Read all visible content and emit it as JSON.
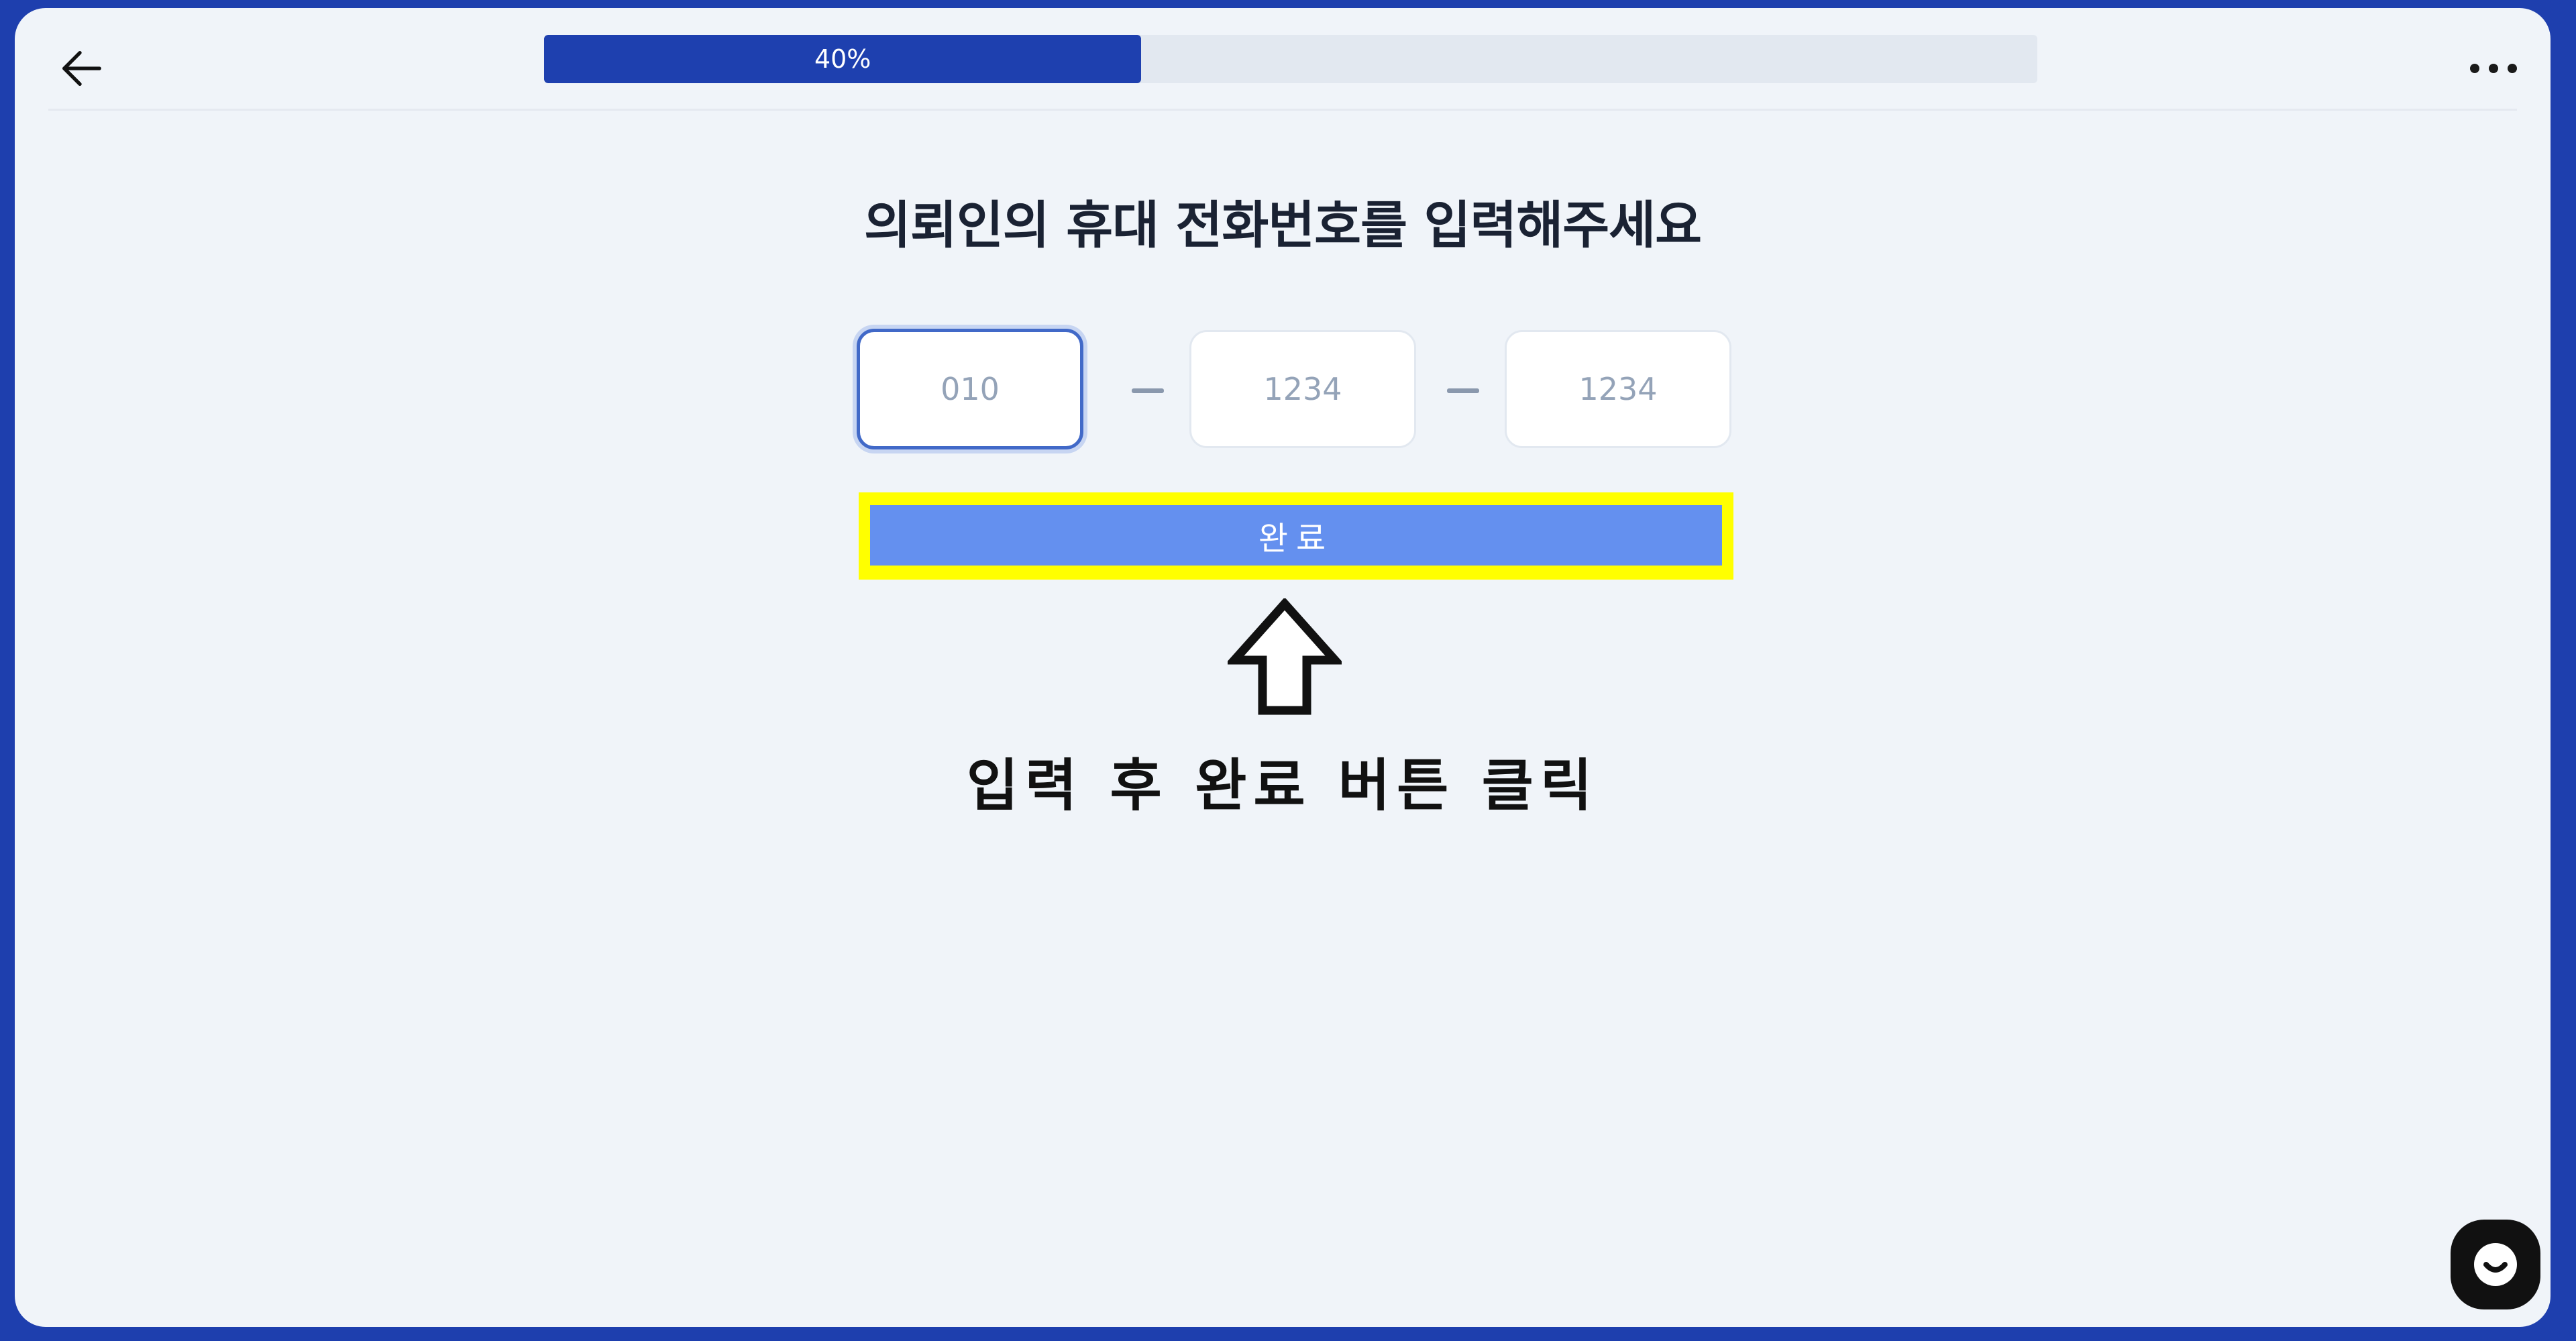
{
  "header": {
    "back_icon": "arrow-left-icon",
    "more_icon": "more-horizontal-icon",
    "progress": {
      "value_percent": 40,
      "label": "40%",
      "fill_color": "#1e40af",
      "track_color": "#e2e8f0"
    }
  },
  "main": {
    "title": "의뢰인의 휴대 전화번호를 입력해주세요",
    "phone": {
      "part1": {
        "value": "",
        "placeholder": "010"
      },
      "part2": {
        "value": "",
        "placeholder": "1234"
      },
      "part3": {
        "value": "",
        "placeholder": "1234"
      }
    },
    "submit_label": "완료",
    "submit_color": "#6490ef"
  },
  "annotation": {
    "highlight_color": "#ffff00",
    "arrow_icon": "arrow-up-outline-icon",
    "instruction": "입력 후 완료 버튼 클릭"
  },
  "chat": {
    "icon": "chat-smile-icon"
  }
}
